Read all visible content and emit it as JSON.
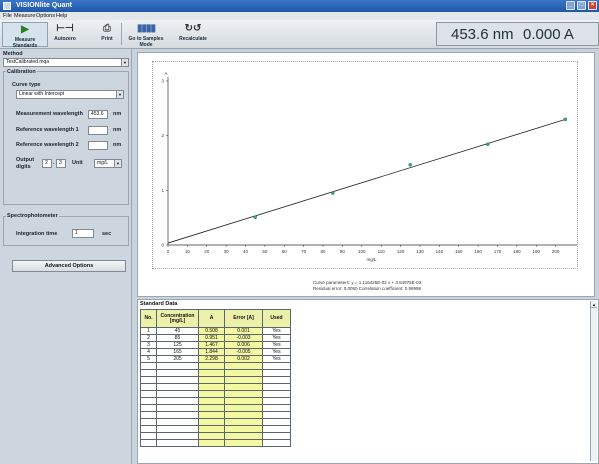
{
  "window": {
    "title": "VISIONlite Quant"
  },
  "menu": [
    "File",
    "Measure",
    "Options",
    "Help"
  ],
  "toolbar": [
    {
      "label": "Measure Standards",
      "icon": "play-icon"
    },
    {
      "label": "Autozero",
      "icon": "autozero-icon"
    },
    {
      "label": "Print",
      "icon": "print-icon"
    },
    {
      "label": "Go to Samples Mode",
      "icon": "samples-icon"
    },
    {
      "label": "Recalculate",
      "icon": "recalculate-icon"
    }
  ],
  "readout": {
    "wavelength": "453.6 nm",
    "absorbance": "0.000  A"
  },
  "method": {
    "label": "Method",
    "value": "TestCalibrated.mqa"
  },
  "calibration": {
    "label": "Calibration",
    "curve_type_label": "Curve type",
    "curve_type": "Linear with Intercept",
    "meas_wl_label": "Measurement wavelength",
    "meas_wl": "453.6",
    "ref_wl1_label": "Reference wavelength 1",
    "ref_wl1": "",
    "ref_wl2_label": "Reference wavelength 2",
    "ref_wl2": "",
    "nm": "nm",
    "output_label": "Output",
    "digits_label": "digits",
    "digits_int": "2",
    "digits_dec": "3",
    "unit_label": "Unit",
    "unit": "mg/L"
  },
  "spectro": {
    "label": "Spectrophotometer",
    "integration_label": "Integration time",
    "integration": "1",
    "sec": "sec"
  },
  "advanced_button": "Advanced Options",
  "chart_data": {
    "type": "line",
    "xlabel": "mg/L",
    "ylabel": "A",
    "xlim": [
      0,
      210
    ],
    "ylim": [
      0,
      3
    ],
    "x_ticks": [
      0,
      10,
      20,
      30,
      40,
      50,
      60,
      70,
      80,
      90,
      100,
      110,
      120,
      130,
      140,
      150,
      160,
      170,
      180,
      190,
      200
    ],
    "y_ticks": [
      0,
      1,
      2,
      3
    ],
    "points": [
      {
        "x": 45,
        "y": 0.508
      },
      {
        "x": 85,
        "y": 0.951
      },
      {
        "x": 125,
        "y": 1.467
      },
      {
        "x": 165,
        "y": 1.844
      },
      {
        "x": 205,
        "y": 2.298
      }
    ],
    "fit_line": [
      [
        0,
        0.0355
      ],
      [
        205,
        2.298
      ]
    ],
    "grid": false
  },
  "curve_caption": {
    "line1": "Curve parameters: y = 1.116425E-02 x + 3.54975E-03",
    "line2": "Residual error: 0.0050    Correlation coefficient: 0.99998"
  },
  "standard": {
    "title": "Standard Data",
    "headers": [
      "No.",
      "Concentration [mg/L]",
      "A",
      "Error [A]",
      "Used"
    ],
    "rows": [
      [
        "1",
        "45",
        "0.508",
        "0.001",
        "Yes"
      ],
      [
        "2",
        "85",
        "0.951",
        "-0.003",
        "Yes"
      ],
      [
        "3",
        "125",
        "1.467",
        "0.006",
        "Yes"
      ],
      [
        "4",
        "165",
        "1.844",
        "-0.005",
        "Yes"
      ],
      [
        "5",
        "205",
        "2.298",
        "0.002",
        "Yes"
      ]
    ]
  }
}
